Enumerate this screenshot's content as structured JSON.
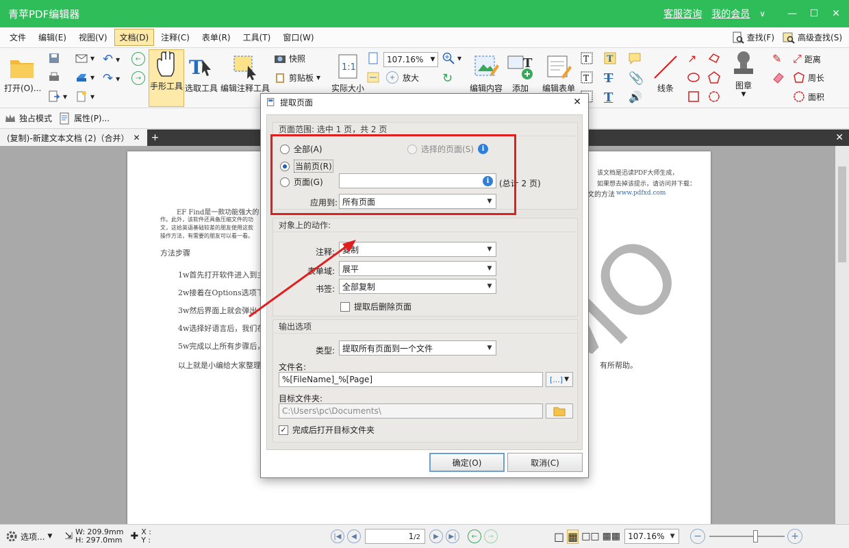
{
  "app": {
    "title": "青苹PDF编辑器",
    "service_link": "客服咨询",
    "member_link": "我的会员"
  },
  "menu": {
    "items": [
      "文件",
      "编辑(E)",
      "视图(V)",
      "文档(D)",
      "注释(C)",
      "表单(R)",
      "工具(T)",
      "窗口(W)"
    ],
    "active_index": 3,
    "find": "查找(F)",
    "advanced_find": "高级查找(S)"
  },
  "ribbon": {
    "open": "打开(O)...",
    "hand_tool": "手形工具",
    "select_text": "选取工具",
    "edit_annot": "编辑注释工具",
    "snapshot": "快照",
    "clipboard": "剪贴板",
    "actual_size": "实际大小",
    "zoom_value": "107.16%",
    "zoom_in": "放大",
    "edit_content": "编辑内容",
    "add": "添加",
    "edit_form": "编辑表单",
    "lines": "线条",
    "stamp": "图章",
    "distance": "距离",
    "perimeter": "周长",
    "area": "面积"
  },
  "toolbar2": {
    "exclusive_mode": "独占模式",
    "properties": "属性(P)..."
  },
  "tab": {
    "label": "(复制)-新建文本文档 (2)（合并）"
  },
  "document": {
    "header_note_1": "该文档是迅读PDF大师生成，",
    "header_note_2": "如果想去掉该提示，请访问并下载：",
    "header_link": "www.pdfxd.com",
    "line_title_tail": "文的方法",
    "para1": "EF Find是一款功能强大的",
    "para2": "作。此外，该软件还具备压缩文件的功",
    "para3": "文，这给英语基础较差的朋友使用这款",
    "para4": "操作方法，有需要的朋友可以看一看。",
    "steps_heading": "方法步骤",
    "step1": "1w首先打开软件进入到主",
    "step2": "2w接着在Options选项下",
    "step3": "3w然后界面上就会弹出一",
    "step4": "4w选择好语言后，我们在",
    "step5": "5w完成以上所有步骤后，",
    "closing": "以上就是小编给大家整理",
    "closing_tail": "有所帮助。",
    "watermark": "DEMO"
  },
  "dialog": {
    "title": "提取页面",
    "range_group": "页面范围: 选中 1 页，共 2 页",
    "all_label": "全部(A)",
    "selected_pages_label": "选择的页面(S)",
    "current_page_label": "当前页(R)",
    "pages_label": "页面(G)",
    "pages_value": "",
    "total_text": "(总计 2 页)",
    "apply_to_label": "应用到:",
    "apply_to_value": "所有页面",
    "actions_group": "对象上的动作:",
    "annot_label": "注释:",
    "annot_value": "复制",
    "form_label": "表单域:",
    "form_value": "展平",
    "bookmark_label": "书签:",
    "bookmark_value": "全部复制",
    "delete_after_label": "提取后删除页面",
    "delete_after_checked": false,
    "output_group": "输出选项",
    "type_label": "类型:",
    "type_value": "提取所有页面到一个文件",
    "filename_label": "文件名:",
    "filename_value": "%[FileName]_%[Page]",
    "folder_label": "目标文件夹:",
    "folder_value": "C:\\Users\\pc\\Documents\\",
    "open_folder_label": "完成后打开目标文件夹",
    "open_folder_checked": true,
    "ok": "确定(O)",
    "cancel": "取消(C)"
  },
  "status": {
    "options": "选项...",
    "width": "W: 209.9mm",
    "height": "H: 297.0mm",
    "x": "X :",
    "y": "Y :",
    "page_value": "1",
    "page_total": "/2",
    "zoom": "107.16%"
  },
  "colors": {
    "titlebar": "#2ebd59",
    "highlight": "#e01e1e",
    "active_menu": "#fde9a8"
  }
}
